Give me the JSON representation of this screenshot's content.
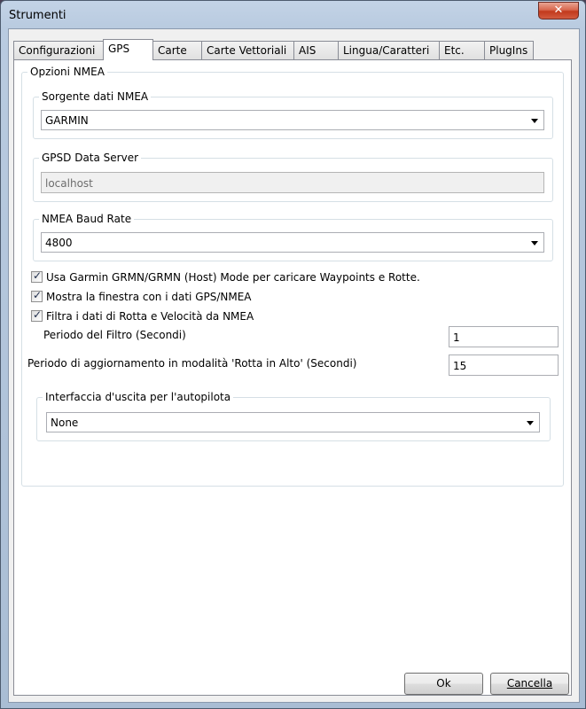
{
  "window": {
    "title": "Strumenti",
    "close_glyph": "✕"
  },
  "tabs": [
    {
      "label": "Configurazioni"
    },
    {
      "label": "GPS"
    },
    {
      "label": "Carte"
    },
    {
      "label": "Carte Vettoriali"
    },
    {
      "label": "AIS"
    },
    {
      "label": "Lingua/Caratteri"
    },
    {
      "label": "Etc."
    },
    {
      "label": "PlugIns"
    }
  ],
  "active_tab": "GPS",
  "nmea": {
    "group_title": "Opzioni NMEA",
    "source": {
      "label": "Sorgente dati NMEA",
      "value": "GARMIN"
    },
    "gpsd": {
      "label": "GPSD Data Server",
      "value": "localhost"
    },
    "baud": {
      "label": "NMEA Baud Rate",
      "value": "4800"
    },
    "checkboxes": [
      {
        "label": "Usa Garmin GRMN/GRMN (Host) Mode per caricare Waypoints e Rotte.",
        "checked": true
      },
      {
        "label": "Mostra la finestra con i dati GPS/NMEA",
        "checked": true
      },
      {
        "label": "Filtra i dati di Rotta e Velocità da NMEA",
        "checked": true
      }
    ],
    "check_glyph": "✓",
    "filter_period": {
      "label": "Periodo del Filtro (Secondi)",
      "value": "1"
    },
    "update_period": {
      "label": "Periodo di aggiornamento in modalità 'Rotta in Alto' (Secondi)",
      "value": "15"
    },
    "autopilot": {
      "label": "Interfaccia d'uscita per l'autopilota",
      "value": "None"
    }
  },
  "buttons": {
    "ok": "Ok",
    "cancel": "Cancella"
  }
}
